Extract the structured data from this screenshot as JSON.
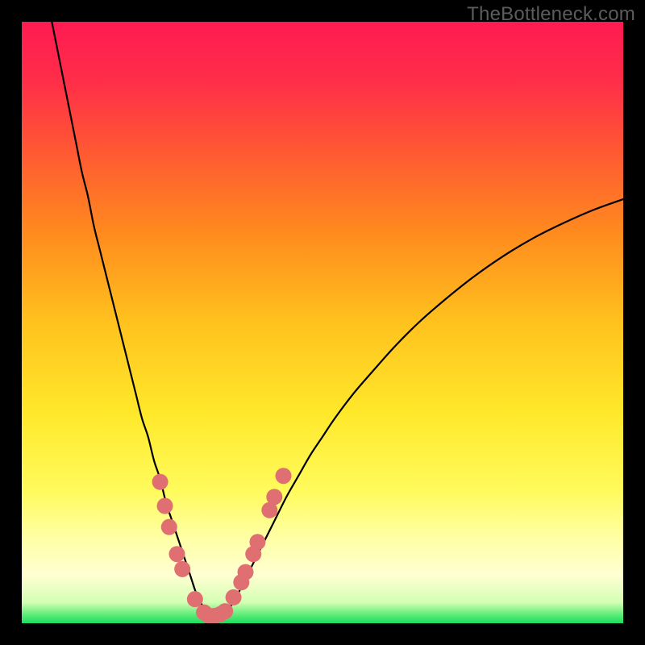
{
  "watermark": "TheBottleneck.com",
  "colors": {
    "frame": "#000000",
    "gradient_stops": [
      {
        "offset": 0.0,
        "color": "#ff1a52"
      },
      {
        "offset": 0.1,
        "color": "#ff2e48"
      },
      {
        "offset": 0.22,
        "color": "#ff5a32"
      },
      {
        "offset": 0.35,
        "color": "#ff8a1e"
      },
      {
        "offset": 0.5,
        "color": "#ffc21e"
      },
      {
        "offset": 0.65,
        "color": "#ffe82a"
      },
      {
        "offset": 0.78,
        "color": "#fffb5c"
      },
      {
        "offset": 0.86,
        "color": "#ffffa6"
      },
      {
        "offset": 0.92,
        "color": "#ffffd2"
      },
      {
        "offset": 0.965,
        "color": "#d4ffb4"
      },
      {
        "offset": 0.99,
        "color": "#46e86c"
      },
      {
        "offset": 1.0,
        "color": "#1ede62"
      }
    ],
    "curve": "#000000",
    "markers": "#e06f72"
  },
  "chart_data": {
    "type": "line",
    "title": "",
    "xlabel": "",
    "ylabel": "",
    "xlim": [
      0,
      100
    ],
    "ylim": [
      0,
      100
    ],
    "grid": false,
    "legend": false,
    "series": [
      {
        "name": "bottleneck-curve",
        "x": [
          5,
          6,
          7,
          8,
          9,
          10,
          11,
          12,
          13,
          14,
          15,
          16,
          17,
          18,
          19,
          20,
          21,
          22,
          23,
          24,
          25,
          26,
          27,
          28,
          29,
          30,
          31,
          32,
          33,
          34,
          35,
          36,
          37,
          38,
          40,
          42,
          44,
          46,
          48,
          50,
          52,
          55,
          58,
          62,
          66,
          70,
          75,
          80,
          85,
          90,
          95,
          100
        ],
        "y": [
          100,
          95,
          90,
          85,
          80,
          75,
          71,
          66,
          62,
          58,
          54,
          50,
          46,
          42,
          38,
          34,
          31,
          27,
          24,
          20,
          17,
          14,
          11,
          8,
          5,
          3,
          1.5,
          1,
          1.3,
          2,
          3.2,
          5,
          7,
          9,
          13,
          17,
          21,
          24.5,
          28,
          31,
          34,
          38,
          41.5,
          46,
          50,
          53.5,
          57.5,
          61,
          64,
          66.5,
          68.7,
          70.5
        ]
      }
    ],
    "markers": [
      {
        "x": 23.0,
        "y": 23.5
      },
      {
        "x": 23.8,
        "y": 19.5
      },
      {
        "x": 24.5,
        "y": 16.0
      },
      {
        "x": 25.8,
        "y": 11.5
      },
      {
        "x": 26.7,
        "y": 9.0
      },
      {
        "x": 28.8,
        "y": 4.0
      },
      {
        "x": 30.3,
        "y": 1.8
      },
      {
        "x": 31.0,
        "y": 1.3
      },
      {
        "x": 32.0,
        "y": 1.2
      },
      {
        "x": 33.0,
        "y": 1.5
      },
      {
        "x": 33.8,
        "y": 2.0
      },
      {
        "x": 35.2,
        "y": 4.3
      },
      {
        "x": 36.5,
        "y": 6.8
      },
      {
        "x": 37.2,
        "y": 8.5
      },
      {
        "x": 38.5,
        "y": 11.5
      },
      {
        "x": 39.2,
        "y": 13.5
      },
      {
        "x": 41.2,
        "y": 18.8
      },
      {
        "x": 42.0,
        "y": 21.0
      },
      {
        "x": 43.5,
        "y": 24.5
      }
    ],
    "marker_radius_px": 10
  }
}
